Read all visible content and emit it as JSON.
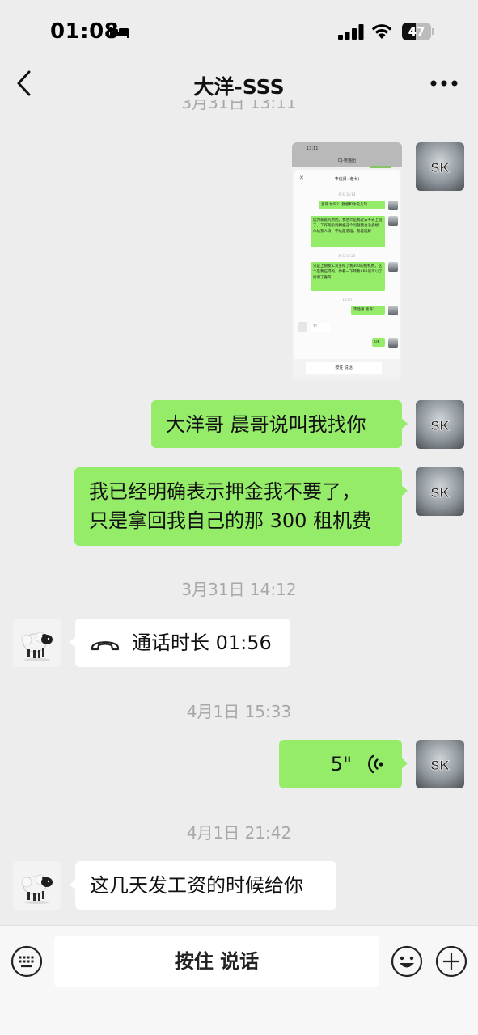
{
  "status_bar": {
    "time": "01:08",
    "battery": "47",
    "battery_level": 0.47
  },
  "header": {
    "title": "大洋-SSS"
  },
  "messages": {
    "ts_partial": "3月31日 13:11",
    "screenshot": {
      "time": "13:11",
      "top_title": "DJ-熊猫团",
      "chat_title": "李佳男 (老大)",
      "ts1": "昨天 16:14",
      "bubble1": "喜哥 忙吗？ 我想和你说几句",
      "bubble2": "因为家庭的原因，我估计是我过去不去上班了，工作期没到押金这个问题我也没多想，你给我人情，不给是道理，我能理解",
      "ts2": "昨天 16:20",
      "bubble3": "只是上期发工资多扣了我300的租机费，这个是我应得的，你看一下转我ABA就可以了 谢谢了喜哥",
      "ts3": "13:10",
      "bubble4": "李佳男 喜哥?",
      "voice_other": "2\"",
      "bubble_ok": "OK",
      "input": "按住 说话"
    },
    "msg1": "大洋哥  晨哥说叫我找你",
    "msg2_line1": "我已经明确表示押金我不要了，",
    "msg2_line2": "只是拿回我自己的那 300 租机费",
    "ts_call": "3月31日 14:12",
    "call_text": "通话时长 01:56",
    "ts_voice": "4月1日 15:33",
    "voice_duration": "5\"",
    "ts_last": "4月1日 21:42",
    "last_msg": "这几天发工资的时候给你"
  },
  "input_bar": {
    "hold_to_talk": "按住 说话"
  }
}
